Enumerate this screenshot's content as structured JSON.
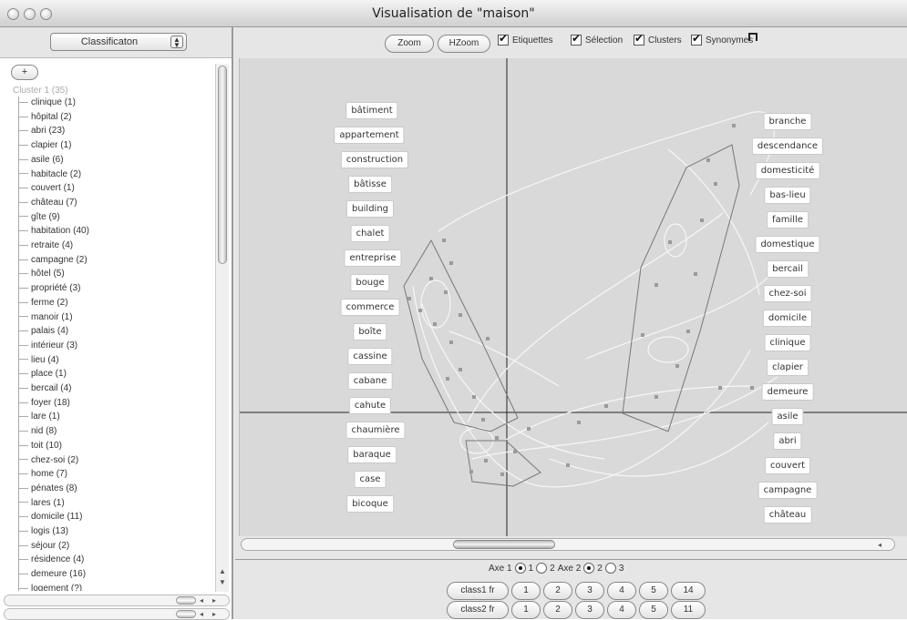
{
  "window": {
    "title": "Visualisation de \"maison\""
  },
  "left": {
    "select_value": "Classificaton",
    "add_label": "+",
    "cluster_root": "Cluster 1  (35)",
    "items": [
      "clinique (1)",
      "hôpital (2)",
      "abri (23)",
      "clapier (1)",
      "asile (6)",
      "habitacle (2)",
      "couvert (1)",
      "château (7)",
      "gîte (9)",
      "habitation (40)",
      "retraite (4)",
      "campagne (2)",
      "hôtel (5)",
      "propriété (3)",
      "ferme (2)",
      "manoir (1)",
      "palais (4)",
      "intérieur (3)",
      "lieu (4)",
      "place (1)",
      "bercail (4)",
      "foyer (18)",
      "lare (1)",
      "nid (8)",
      "toit (10)",
      "chez-soi (2)",
      "home (7)",
      "pénates (8)",
      "lares (1)",
      "domicile (11)",
      "logis (13)",
      "séjour (2)",
      "résidence (4)",
      "demeure (16)",
      "logement (?)"
    ]
  },
  "toolbar": {
    "zoom": "Zoom",
    "hzoom": "HZoom",
    "check_labels": [
      "Etiquettes",
      "Sélection",
      "Clusters",
      "Synonymes"
    ]
  },
  "plot": {
    "left_words": [
      "bâtiment",
      "appartement",
      "construction",
      "bâtisse",
      "building",
      "chalet",
      "entreprise",
      "bouge",
      "commerce",
      "boîte",
      "cassine",
      "cabane",
      "cahute",
      "chaumière",
      "baraque",
      "case",
      "bicoque"
    ],
    "right_words": [
      "branche",
      "descendance",
      "domesticité",
      "bas-lieu",
      "famille",
      "domestique",
      "bercail",
      "chez-soi",
      "domicile",
      "clinique",
      "clapier",
      "demeure",
      "asile",
      "abri",
      "couvert",
      "campagne",
      "château"
    ]
  },
  "bottom": {
    "axe1": "Axe 1",
    "axe2": "Axe 2",
    "opt1": "1",
    "opt2": "2",
    "opt2b": "2",
    "opt3": "3",
    "class1": {
      "label": "class1 fr",
      "values": [
        "1",
        "2",
        "3",
        "4",
        "5",
        "14"
      ]
    },
    "class2": {
      "label": "class2 fr",
      "values": [
        "1",
        "2",
        "3",
        "4",
        "5",
        "11"
      ]
    }
  }
}
